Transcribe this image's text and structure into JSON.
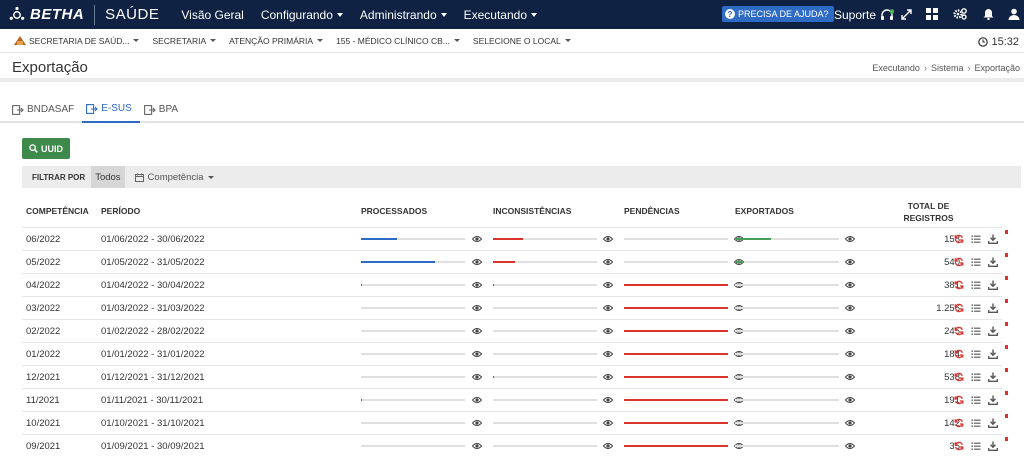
{
  "app": {
    "brand": "BETHA",
    "product": "SAÚDE",
    "nav": [
      "Visão Geral",
      "Configurando",
      "Administrando",
      "Executando"
    ],
    "help_label": "PRECISA DE AJUDA?",
    "support_label": "Suporte"
  },
  "context": {
    "items": [
      "SECRETARIA DE SAÚD...",
      "SECRETARIA",
      "ATENÇÃO PRIMÁRIA",
      "155 - MÉDICO CLÍNICO CB...",
      "SELECIONE O LOCAL"
    ],
    "time": "15:32"
  },
  "page": {
    "title": "Exportação",
    "breadcrumb": [
      "Executando",
      "Sistema",
      "Exportação"
    ]
  },
  "tabs": [
    "BNDASAF",
    "E-SUS",
    "BPA"
  ],
  "active_tab": "E-SUS",
  "uuid_button": "UUID",
  "filter": {
    "label": "FILTRAR POR",
    "selected": "Todos",
    "competencia": "Competência"
  },
  "table": {
    "columns": {
      "competencia": "COMPETÊNCIA",
      "periodo": "PERÍODO",
      "processados": "PROCESSADOS",
      "inconsistencias": "INCONSISTÊNCIAS",
      "pendencias": "PENDÊNCIAS",
      "exportados": "EXPORTADOS",
      "total_line1": "TOTAL DE",
      "total_line2": "REGISTROS"
    },
    "colors": {
      "processados": "#2d6bc4",
      "inconsistencias": "#d9342b",
      "pendencias": "#d9342b",
      "exportados": "#4a9e5c"
    },
    "rows": [
      {
        "competencia": "06/2022",
        "periodo": "01/06/2022 - 30/06/2022",
        "processados": 0.35,
        "inconsistencias": 0.29,
        "pendencias": 0,
        "exportados": 0.35,
        "total": "158"
      },
      {
        "competencia": "05/2022",
        "periodo": "01/05/2022 - 31/05/2022",
        "processados": 0.71,
        "inconsistencias": 0.21,
        "pendencias": 0,
        "exportados": 0.09,
        "total": "540"
      },
      {
        "competencia": "04/2022",
        "periodo": "01/04/2022 - 30/04/2022",
        "processados": 0.01,
        "inconsistencias": 0.01,
        "pendencias": 1,
        "exportados": 0,
        "total": "381"
      },
      {
        "competencia": "03/2022",
        "periodo": "01/03/2022 - 31/03/2022",
        "processados": 0,
        "inconsistencias": 0,
        "pendencias": 1,
        "exportados": 0,
        "total": "1.256"
      },
      {
        "competencia": "02/2022",
        "periodo": "01/02/2022 - 28/02/2022",
        "processados": 0,
        "inconsistencias": 0,
        "pendencias": 1,
        "exportados": 0,
        "total": "245"
      },
      {
        "competencia": "01/2022",
        "periodo": "01/01/2022 - 31/01/2022",
        "processados": 0,
        "inconsistencias": 0,
        "pendencias": 1,
        "exportados": 0,
        "total": "184"
      },
      {
        "competencia": "12/2021",
        "periodo": "01/12/2021 - 31/12/2021",
        "processados": 0,
        "inconsistencias": 0.01,
        "pendencias": 1,
        "exportados": 0,
        "total": "538"
      },
      {
        "competencia": "11/2021",
        "periodo": "01/11/2021 - 30/11/2021",
        "processados": 0.01,
        "inconsistencias": 0,
        "pendencias": 1,
        "exportados": 0,
        "total": "191"
      },
      {
        "competencia": "10/2021",
        "periodo": "01/10/2021 - 31/10/2021",
        "processados": 0,
        "inconsistencias": 0,
        "pendencias": 1,
        "exportados": 0,
        "total": "142"
      },
      {
        "competencia": "09/2021",
        "periodo": "01/09/2021 - 30/09/2021",
        "processados": 0,
        "inconsistencias": 0,
        "pendencias": 1,
        "exportados": 0,
        "total": "35"
      }
    ]
  }
}
